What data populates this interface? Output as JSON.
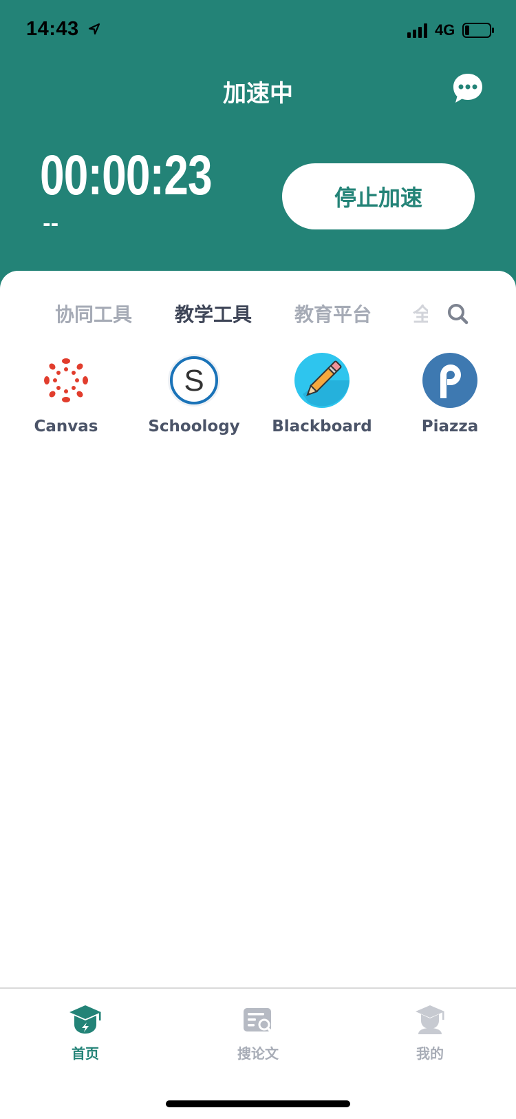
{
  "status_bar": {
    "time": "14:43",
    "network": "4G"
  },
  "header": {
    "title": "加速中",
    "timer": "00:00:23",
    "sub_text": "--",
    "stop_button_label": "停止加速",
    "background_color": "#238377"
  },
  "tabs": [
    {
      "label": "协同工具"
    },
    {
      "label": "教学工具"
    },
    {
      "label": "教育平台"
    },
    {
      "label": "全"
    }
  ],
  "apps": [
    {
      "name": "Canvas",
      "icon": "canvas-logo-icon"
    },
    {
      "name": "Schoology",
      "icon": "schoology-logo-icon"
    },
    {
      "name": "Blackboard",
      "icon": "blackboard-pencil-icon"
    },
    {
      "name": "Piazza",
      "icon": "piazza-logo-icon"
    }
  ],
  "bottom_nav": [
    {
      "label": "首页",
      "icon": "home-graduation-cap-icon"
    },
    {
      "label": "搜论文",
      "icon": "search-paper-icon"
    },
    {
      "label": "我的",
      "icon": "profile-icon"
    }
  ],
  "colors": {
    "accent": "#238377",
    "tab_active": "#3e4557",
    "tab_inactive": "#a6abb6"
  }
}
